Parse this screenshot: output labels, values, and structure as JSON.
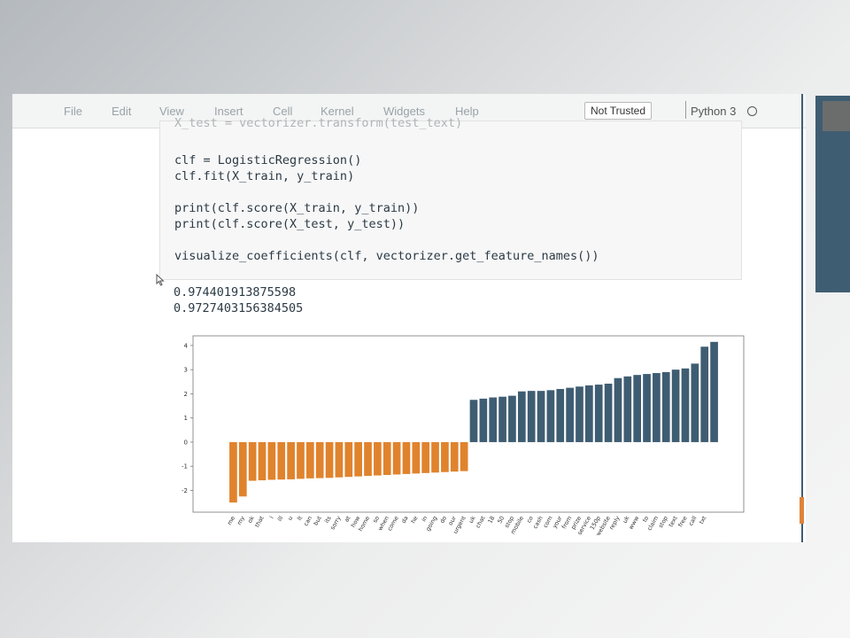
{
  "menu": {
    "items": [
      "File",
      "Edit",
      "View",
      "Insert",
      "Cell",
      "Kernel",
      "Widgets",
      "Help"
    ],
    "trust_status": "Not Trusted",
    "kernel_name": "Python 3"
  },
  "code_cell": {
    "partial_top_line": "X_test = vectorizer.transform(test_text)",
    "lines": [
      "clf = LogisticRegression()",
      "clf.fit(X_train, y_train)",
      "",
      "print(clf.score(X_train, y_train))",
      "print(clf.score(X_test, y_test))",
      "",
      "visualize_coefficients(clf, vectorizer.get_feature_names())"
    ]
  },
  "output": {
    "train_score": "0.974401913875598",
    "test_score": "0.9727403156384505"
  },
  "colors": {
    "negative_bar": "#e0832d",
    "positive_bar": "#3f5d72",
    "menu_text": "#9aa3a8",
    "code_text": "#2b3a45"
  },
  "icons": {
    "kernel_status": "kernel-idle-circle-icon",
    "mouse_pointer": "mouse-pointer-icon"
  },
  "chart_data": {
    "type": "bar",
    "title": "",
    "xlabel": "",
    "ylabel": "",
    "ylim": [
      -2.9,
      4.4
    ],
    "yticks": [
      -2,
      -1,
      0,
      1,
      2,
      3,
      4
    ],
    "grid": false,
    "categories": [
      "me",
      "my",
      "ok",
      "that",
      "i",
      "ill",
      "u",
      "lt",
      "can",
      "but",
      "its",
      "sorry",
      "at",
      "how",
      "home",
      "so",
      "when",
      "come",
      "da",
      "he",
      "in",
      "going",
      "do",
      "our",
      "urgent",
      "uk",
      "chat",
      "18",
      "50",
      "stop",
      "mobile",
      "co",
      "cash",
      "com",
      "your",
      "from",
      "prize",
      "service",
      "150p",
      "website",
      "reply",
      "uk",
      "www",
      "to",
      "claim",
      "stop",
      "text",
      "free",
      "call",
      "txt"
    ],
    "values": [
      -2.5,
      -2.25,
      -1.6,
      -1.58,
      -1.56,
      -1.55,
      -1.54,
      -1.52,
      -1.5,
      -1.49,
      -1.48,
      -1.46,
      -1.44,
      -1.42,
      -1.4,
      -1.38,
      -1.36,
      -1.34,
      -1.32,
      -1.3,
      -1.28,
      -1.26,
      -1.24,
      -1.22,
      -1.2,
      1.75,
      1.8,
      1.85,
      1.88,
      1.92,
      2.1,
      2.12,
      2.12,
      2.15,
      2.2,
      2.25,
      2.3,
      2.35,
      2.38,
      2.42,
      2.65,
      2.72,
      2.78,
      2.82,
      2.86,
      2.9,
      3.0,
      3.05,
      3.25,
      3.95,
      4.15
    ]
  }
}
